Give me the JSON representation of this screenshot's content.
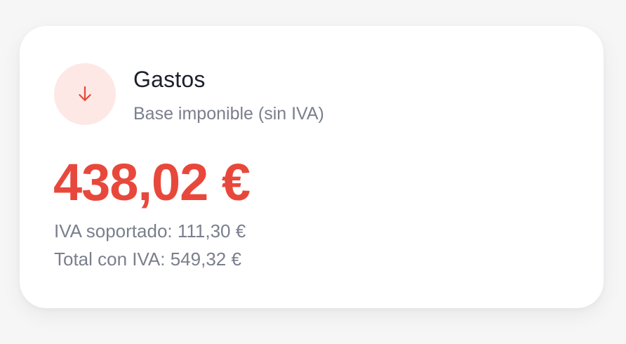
{
  "card": {
    "icon": "arrow-down-icon",
    "accent_color": "#e8483b",
    "icon_bg_color": "#fde8e6",
    "title": "Gastos",
    "subtitle": "Base imponible (sin IVA)",
    "amount": "438,02 €",
    "vat_line": "IVA soportado: 111,30 €",
    "total_line": "Total con IVA: 549,32 €"
  }
}
